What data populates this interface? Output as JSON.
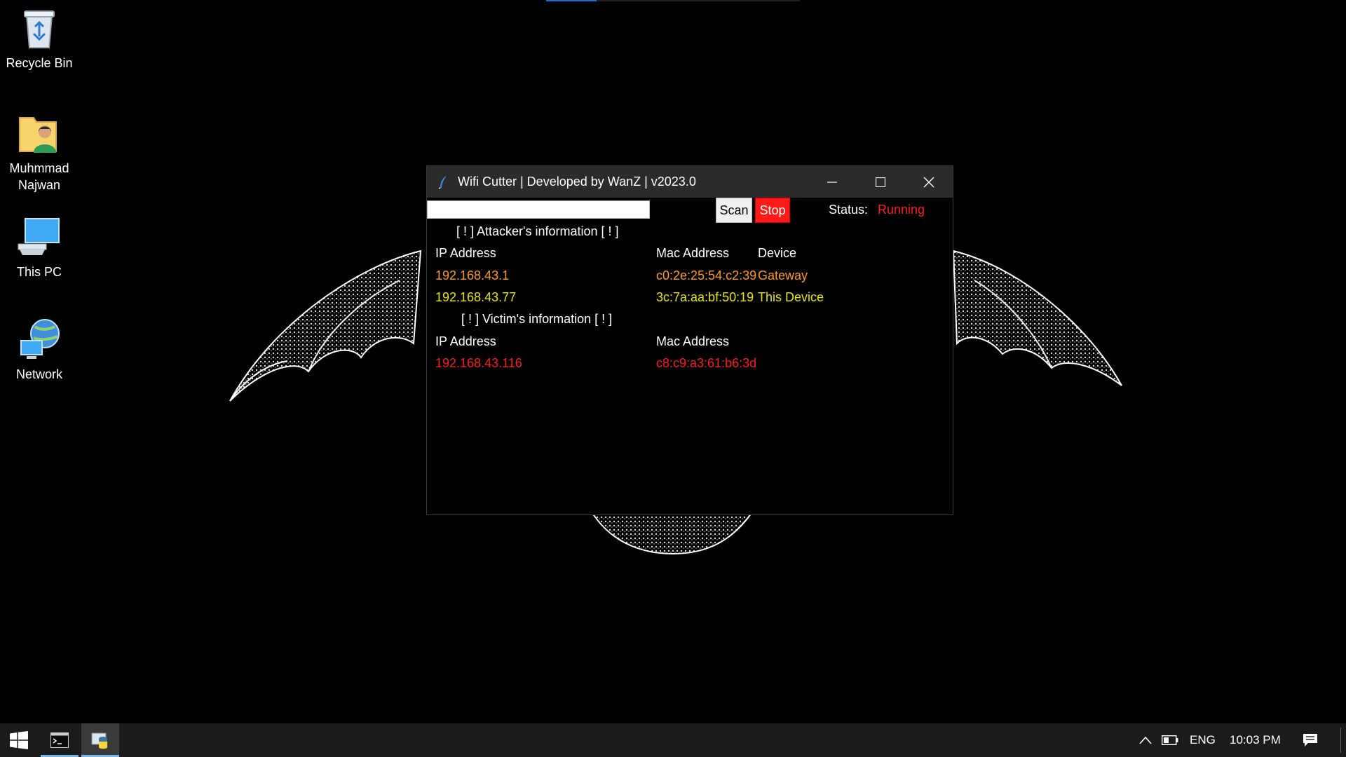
{
  "desktop": {
    "icons": [
      {
        "label": "Recycle Bin",
        "icon": "recycle-bin-icon"
      },
      {
        "label": "Muhmmad\nNajwan",
        "icon": "user-folder-icon"
      },
      {
        "label": "This PC",
        "icon": "this-pc-icon"
      },
      {
        "label": "Network",
        "icon": "network-icon"
      }
    ]
  },
  "window": {
    "title": "Wifi Cutter | Developed by WanZ | v2023.0",
    "input_value": "",
    "scan_label": "Scan",
    "stop_label": "Stop",
    "status_label": "Status:",
    "status_value": "Running",
    "attacker_header": "[ ! ] Attacker's information [ ! ]",
    "attacker_columns": {
      "ip": "IP Address",
      "mac": "Mac Address",
      "device": "Device"
    },
    "attacker_rows": [
      {
        "ip": "192.168.43.1",
        "mac": "c0:2e:25:54:c2:39",
        "device": "Gateway"
      },
      {
        "ip": "192.168.43.77",
        "mac": "3c:7a:aa:bf:50:19",
        "device": "This Device"
      }
    ],
    "victim_header": "[ ! ] Victim's information [ ! ]",
    "victim_columns": {
      "ip": "IP Address",
      "mac": "Mac Address"
    },
    "victim_rows": [
      {
        "ip": "192.168.43.116",
        "mac": "c8:c9:a3:61:b6:3d"
      }
    ]
  },
  "taskbar": {
    "language": "ENG",
    "clock": "10:03 PM"
  },
  "colors": {
    "gateway": "#ff9a1a",
    "this_device": "#e6e600",
    "victim": "#ff1a1a",
    "stop_button": "#ff1a1a"
  }
}
